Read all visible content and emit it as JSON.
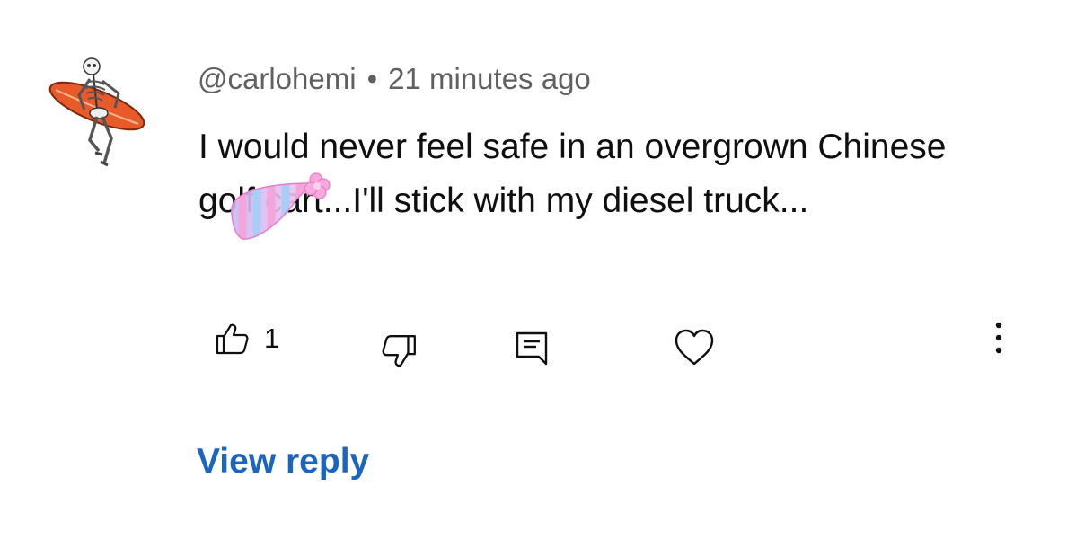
{
  "comment": {
    "author": "@carlohemi",
    "separator": "•",
    "timestamp": "21 minutes ago",
    "text": "I would never feel safe in an overgrown Chinese golf cart...I'll stick with my diesel truck...",
    "avatar_icon": "skeleton-surfboard-icon",
    "sticker_icon": "party-hat-icon"
  },
  "actions": {
    "like_icon": "thumbs-up-icon",
    "like_count": "1",
    "dislike_icon": "thumbs-down-icon",
    "reply_icon": "comment-icon",
    "heart_icon": "heart-icon",
    "more_icon": "more-vertical-icon"
  },
  "view_reply_label": "View reply",
  "colors": {
    "link": "#1a64c2",
    "meta_text": "#606060",
    "body_text": "#0f0f0f",
    "background": "#ffffff"
  }
}
